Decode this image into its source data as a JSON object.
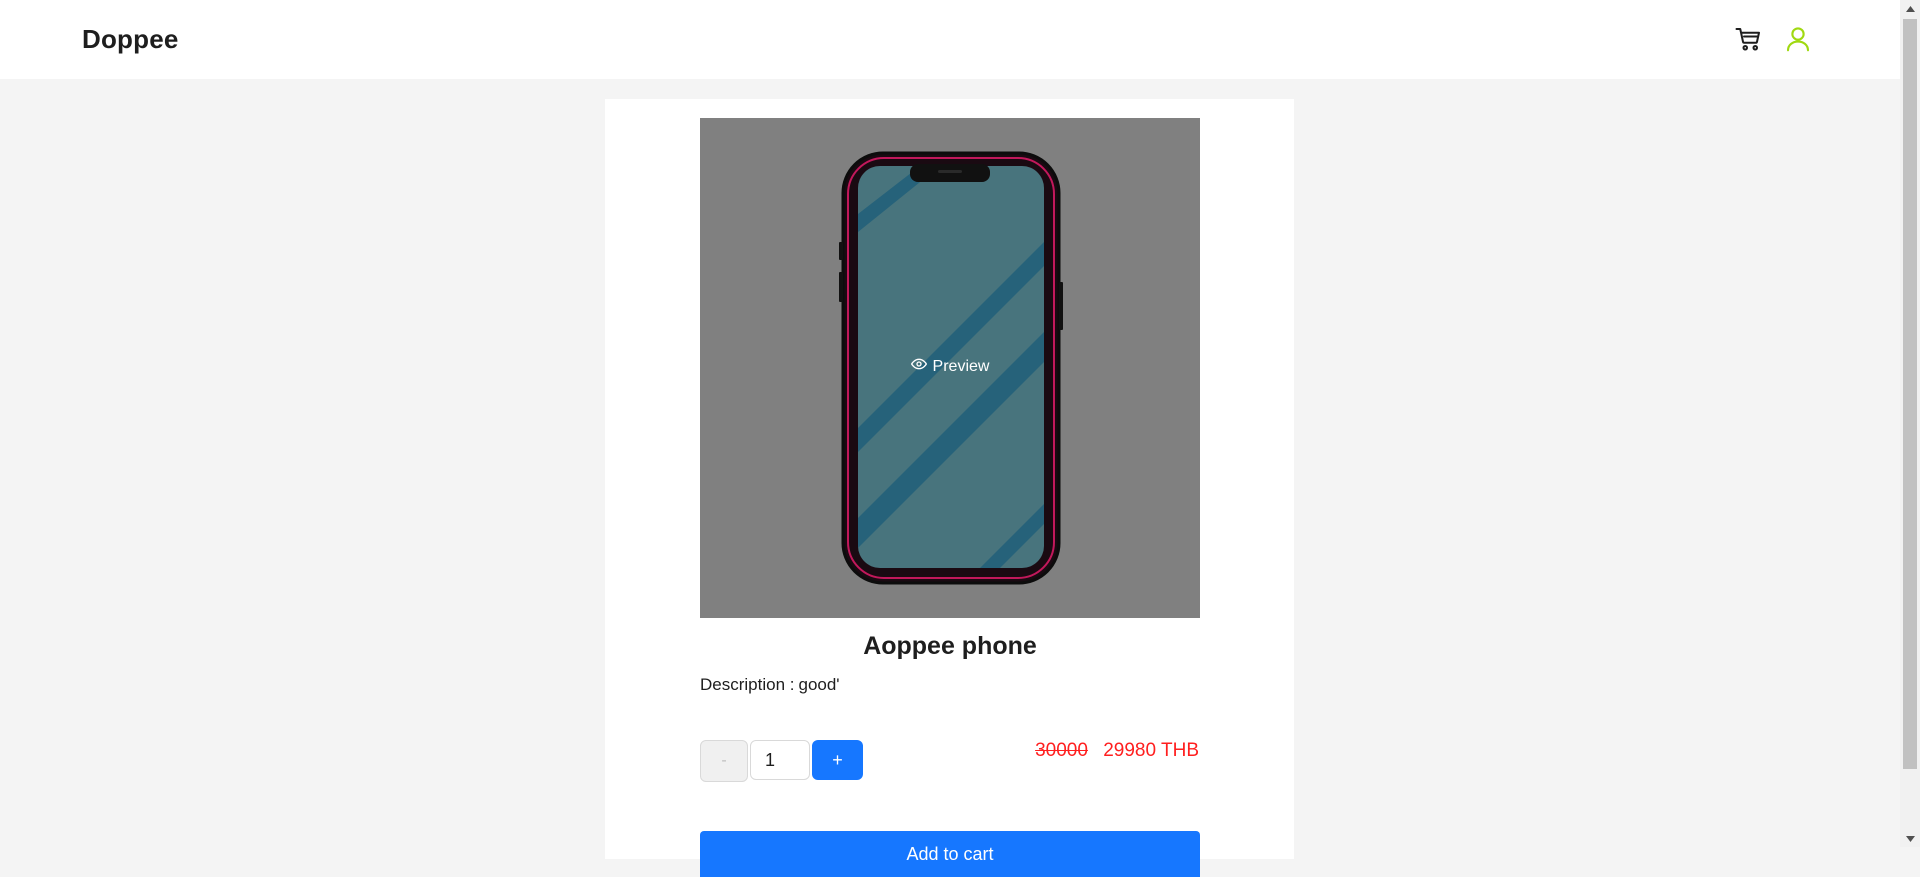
{
  "header": {
    "brand": "Doppee",
    "cart_icon": "cart-icon",
    "user_icon": "user-icon",
    "user_icon_color": "#a0d911"
  },
  "product": {
    "image_overlay_label": "Preview",
    "image_overlay_icon": "eye-icon",
    "name": "Aoppee phone",
    "description_label": "Description :",
    "description_value": "good'",
    "quantity": {
      "decrement_label": "-",
      "value": "1",
      "increment_label": "+"
    },
    "price": {
      "original": "30000",
      "current": "29980 THB",
      "color": "#ff1f1f"
    },
    "add_to_cart_label": "Add to cart"
  },
  "colors": {
    "accent": "#1677ff",
    "background": "#f4f4f4"
  }
}
